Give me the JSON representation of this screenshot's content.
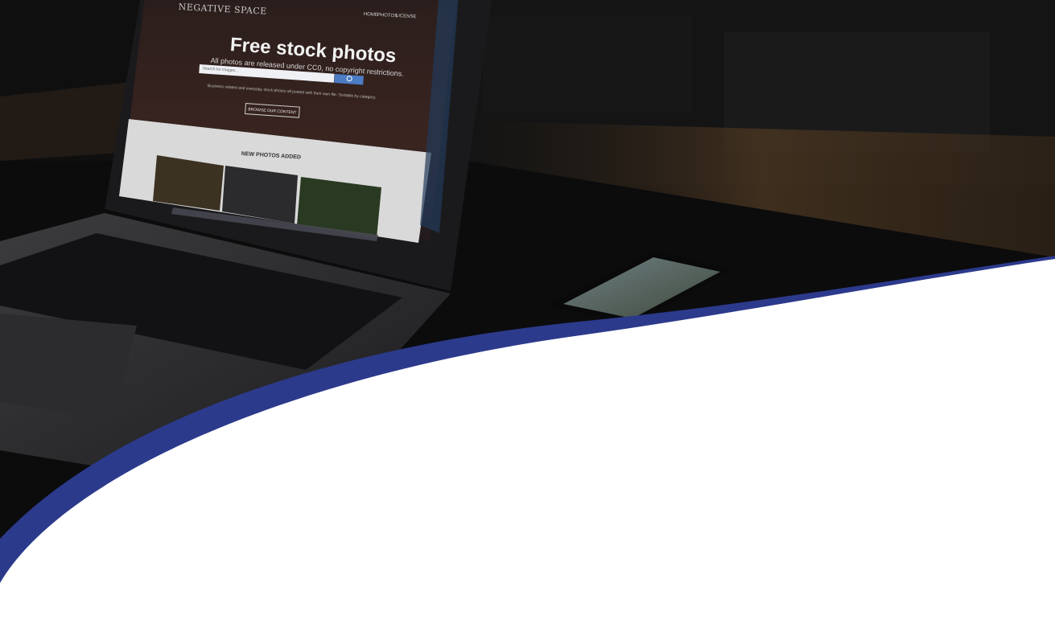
{
  "site": {
    "logo": "NEGATIVE SPACE",
    "nav": [
      "HOME",
      "PHOTOS",
      "LICENSE"
    ],
    "hero_title": "Free stock photos",
    "hero_subtitle": "All photos are released under CC0, no copyright restrictions.",
    "search_placeholder": "Search for images...",
    "description": "Business related and everyday stock photos all posted with their own file. Sortable by category.",
    "browse_label": "BROWSE OUR CONTENT",
    "section_heading": "NEW PHOTOS ADDED"
  },
  "colors": {
    "wave_blue": "#2c3a8c",
    "background": "#ffffff",
    "photo_overlay": "#0e0e0f"
  },
  "icons": [
    "search-icon"
  ]
}
